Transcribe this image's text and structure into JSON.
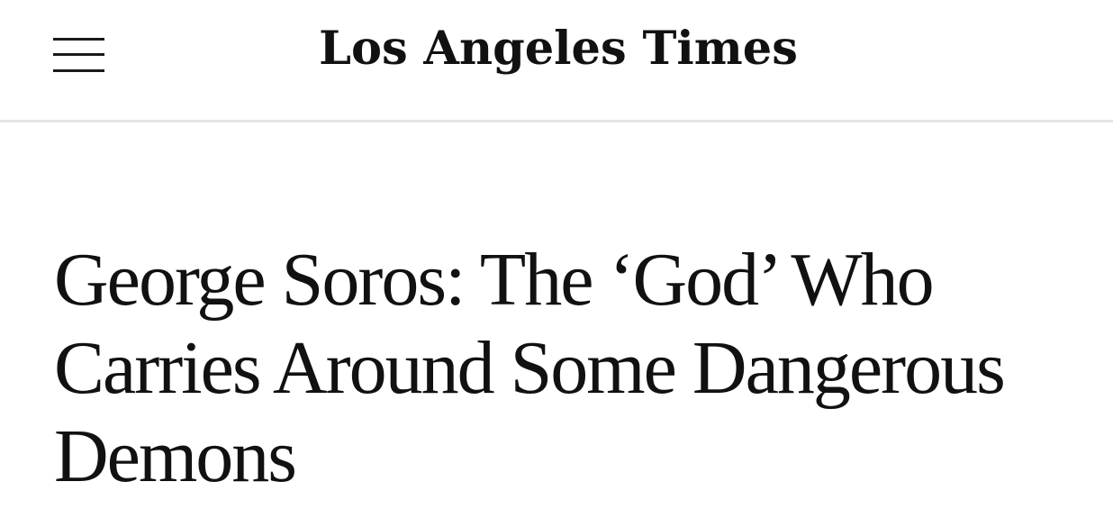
{
  "header": {
    "menu_icon": "hamburger-menu-icon",
    "masthead": "Los Angeles Times"
  },
  "article": {
    "headline": "George Soros: The ‘God’ Who Carries Around Some Dangerous Demons"
  }
}
